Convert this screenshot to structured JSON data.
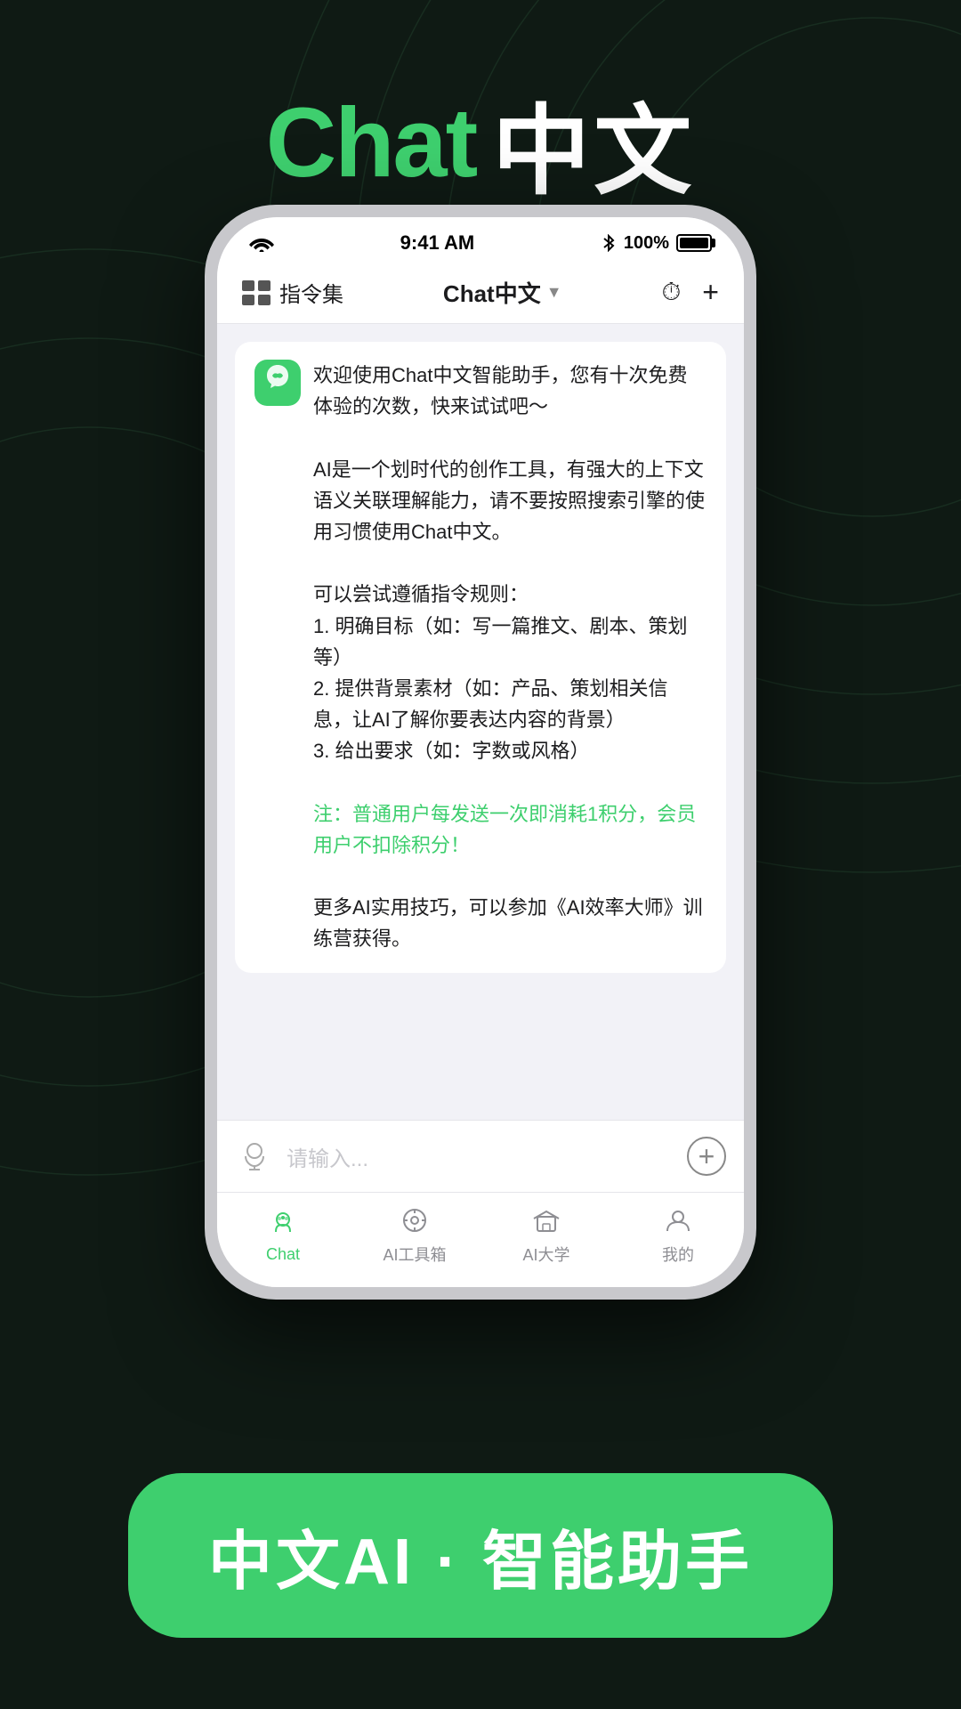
{
  "page": {
    "background_color": "#0f1a14"
  },
  "header": {
    "chat_label": "Chat",
    "chinese_label": "中文"
  },
  "status_bar": {
    "wifi": "wifi",
    "time": "9:41 AM",
    "bluetooth": "bluetooth",
    "battery": "100%"
  },
  "nav": {
    "left_icon": "grid-icon",
    "left_label": "指令集",
    "title": "Chat中文",
    "title_chevron": "▼",
    "history_icon": "history-icon",
    "add_icon": "add-icon"
  },
  "message": {
    "welcome_text": "欢迎使用Chat中文智能助手，您有十次免费体验的次数，快来试试吧～",
    "intro_text": "AI是一个划时代的创作工具，有强大的上下文语义关联理解能力，请不要按照搜索引擎的使用习惯使用Chat中文。",
    "tips_label": "可以尝试遵循指令规则：",
    "tip_1": "1. 明确目标（如：写一篇推文、剧本、策划等）",
    "tip_2": "2. 提供背景素材（如：产品、策划相关信息，让AI了解你要表达内容的背景）",
    "tip_3": "3. 给出要求（如：字数或风格）",
    "notice": "注：普通用户每发送一次即消耗1积分，会员用户不扣除积分！",
    "more_tips": "更多AI实用技巧，可以参加《AI效率大师》训练营获得。"
  },
  "input": {
    "placeholder": "请输入..."
  },
  "tabs": [
    {
      "label": "Chat",
      "active": true,
      "icon": "chat-icon"
    },
    {
      "label": "AI工具箱",
      "active": false,
      "icon": "toolbox-icon"
    },
    {
      "label": "AI大学",
      "active": false,
      "icon": "university-icon"
    },
    {
      "label": "我的",
      "active": false,
      "icon": "profile-icon"
    }
  ],
  "cta": {
    "label": "中文AI · 智能助手"
  }
}
